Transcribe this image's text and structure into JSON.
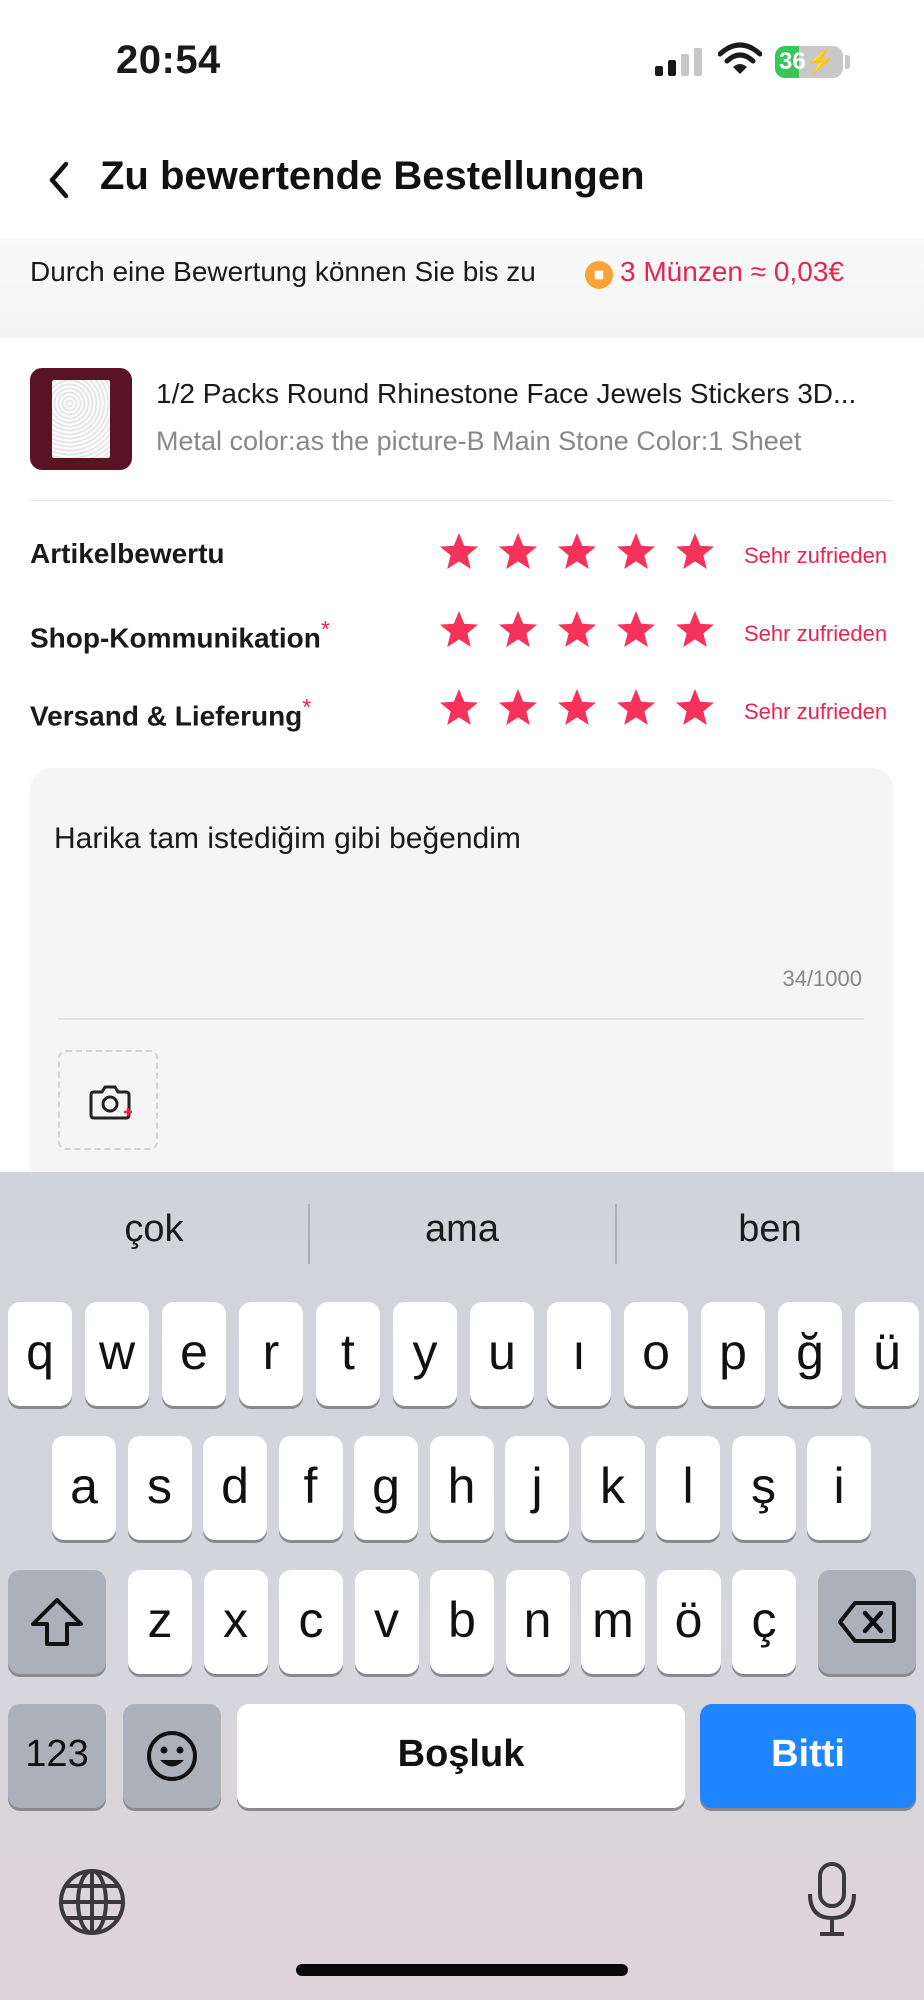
{
  "status_bar": {
    "time": "20:54",
    "battery_level": "36",
    "battery_fraction": 0.36
  },
  "header": {
    "title": "Zu bewertende Bestellungen"
  },
  "banner": {
    "text": "Durch eine Bewertung können Sie bis zu",
    "reward": "3 Münzen ≈ 0,03€"
  },
  "product": {
    "title": "1/2 Packs Round Rhinestone Face Jewels Stickers 3D...",
    "variant": "Metal color:as the picture-B Main Stone Color:1 Sheet"
  },
  "ratings": [
    {
      "label": "Artikelbewertu",
      "required": false,
      "stars": 5,
      "max": 5,
      "text": "Sehr zufrieden"
    },
    {
      "label": "Shop-Kommunikation",
      "required": true,
      "stars": 5,
      "max": 5,
      "text": "Sehr zufrieden"
    },
    {
      "label": "Versand & Lieferung",
      "required": true,
      "stars": 5,
      "max": 5,
      "text": "Sehr zufrieden"
    }
  ],
  "required_mark": "*",
  "review": {
    "text": "Harika tam istediğim gibi beğendim",
    "char_count": "34/1000"
  },
  "photo_upload": {
    "icon": "camera-add-icon"
  },
  "keyboard": {
    "suggestions": [
      "çok",
      "ama",
      "ben"
    ],
    "row1": [
      "q",
      "w",
      "e",
      "r",
      "t",
      "y",
      "u",
      "ı",
      "o",
      "p",
      "ğ",
      "ü"
    ],
    "row2": [
      "a",
      "s",
      "d",
      "f",
      "g",
      "h",
      "j",
      "k",
      "l",
      "ş",
      "i"
    ],
    "row3": [
      "z",
      "x",
      "c",
      "v",
      "b",
      "n",
      "m",
      "ö",
      "ç"
    ],
    "numbers_label": "123",
    "space_label": "Boşluk",
    "done_label": "Bitti"
  },
  "colors": {
    "accent": "#e8254f",
    "star": "#f5335a",
    "done_key": "#1f86ff",
    "battery": "#35c759"
  }
}
